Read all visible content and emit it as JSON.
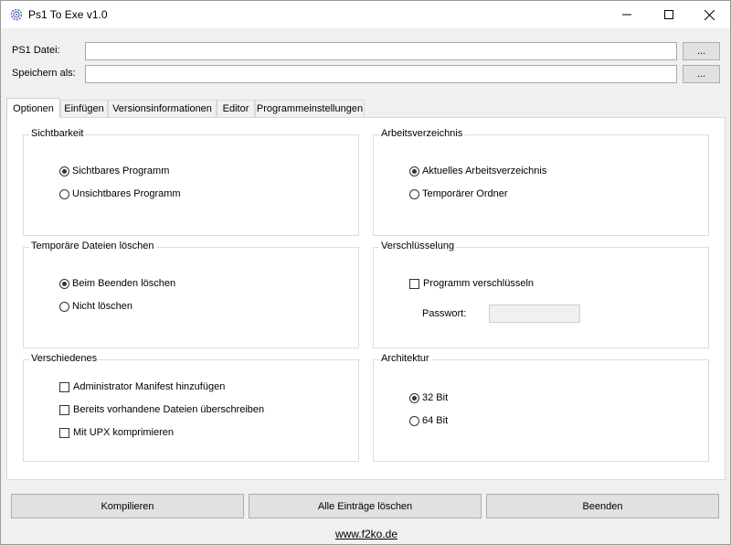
{
  "window": {
    "title": "Ps1 To Exe v1.0",
    "controls": {
      "minimize_icon": "minimize-icon",
      "maximize_icon": "maximize-icon",
      "close_icon": "close-icon"
    }
  },
  "files": {
    "ps1_label": "PS1 Datei:",
    "ps1_value": "",
    "save_label": "Speichern als:",
    "save_value": "",
    "browse_label": "..."
  },
  "tabs": [
    {
      "label": "Optionen",
      "active": true
    },
    {
      "label": "Einfügen",
      "active": false
    },
    {
      "label": "Versionsinformationen",
      "active": false
    },
    {
      "label": "Editor",
      "active": false
    },
    {
      "label": "Programmeinstellungen",
      "active": false
    }
  ],
  "sichtbarkeit": {
    "title": "Sichtbarkeit",
    "options": [
      {
        "label": "Sichtbares Programm",
        "selected": true
      },
      {
        "label": "Unsichtbares Programm",
        "selected": false
      }
    ]
  },
  "arbeitsverzeichnis": {
    "title": "Arbeitsverzeichnis",
    "options": [
      {
        "label": "Aktuelles Arbeitsverzeichnis",
        "selected": true
      },
      {
        "label": "Temporärer Ordner",
        "selected": false
      }
    ]
  },
  "temp_dateien": {
    "title": "Temporäre Dateien löschen",
    "options": [
      {
        "label": "Beim Beenden löschen",
        "selected": true
      },
      {
        "label": "Nicht löschen",
        "selected": false
      }
    ]
  },
  "verschluesselung": {
    "title": "Verschlüsselung",
    "checkbox_label": "Programm verschlüsseln",
    "checked": false,
    "password_label": "Passwort:",
    "password_value": ""
  },
  "verschiedenes": {
    "title": "Verschiedenes",
    "options": [
      {
        "label": "Administrator Manifest hinzufügen",
        "checked": false
      },
      {
        "label": "Bereits vorhandene Dateien überschreiben",
        "checked": false
      },
      {
        "label": "Mit UPX komprimieren",
        "checked": false
      }
    ]
  },
  "architektur": {
    "title": "Architektur",
    "options": [
      {
        "label": "32 Bit",
        "selected": true
      },
      {
        "label": "64 Bit",
        "selected": false
      }
    ]
  },
  "actions": {
    "compile": "Kompilieren",
    "clear_all": "Alle Einträge löschen",
    "exit": "Beenden"
  },
  "footer": {
    "link": "www.f2ko.de"
  }
}
